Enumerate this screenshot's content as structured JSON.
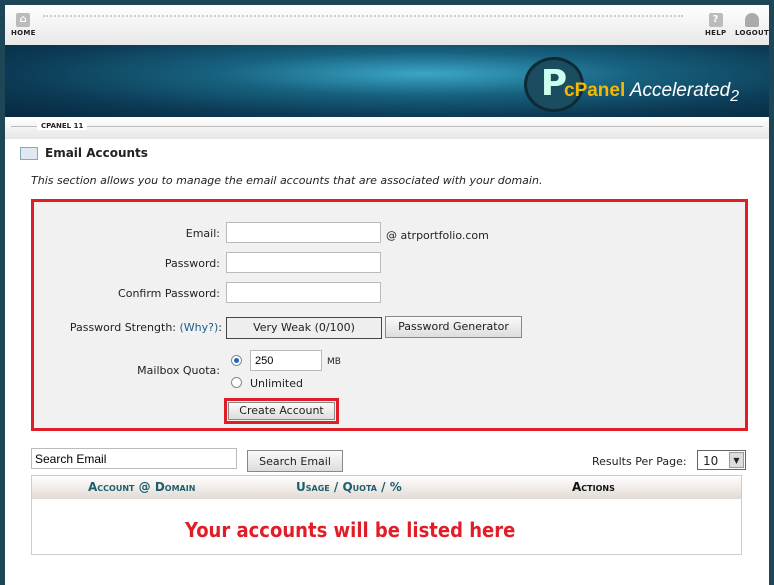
{
  "topbar": {
    "home": "HOME",
    "help": "HELP",
    "logout": "LOGOUT"
  },
  "banner": {
    "logo": "cPanel Accelerated 2"
  },
  "breadcrumb": "CPANEL 11",
  "page": {
    "title": "Email Accounts",
    "description": "This section allows you to manage the email accounts that are associated with your domain."
  },
  "form": {
    "email_label": "Email:",
    "email_value": "",
    "domain": "@ atrportfolio.com",
    "password_label": "Password:",
    "confirm_label": "Confirm Password:",
    "strength_label": "Password Strength:",
    "why": "(Why?)",
    "strength_value": "Very Weak (0/100)",
    "generator": "Password Generator",
    "quota_label": "Mailbox Quota:",
    "quota_value": "250",
    "quota_unit": "MB",
    "unlimited": "Unlimited",
    "quota_selected": "250",
    "create": "Create Account"
  },
  "search": {
    "value": "Search Email",
    "button": "Search Email",
    "rpp_label": "Results Per Page:",
    "rpp_value": "10"
  },
  "table": {
    "columns": [
      "Account @ Domain",
      "Usage / Quota / %",
      "Actions"
    ],
    "message": "Your accounts will be listed here"
  },
  "colors": {
    "highlight": "#e11d28",
    "header_link": "#1c5f6e"
  }
}
